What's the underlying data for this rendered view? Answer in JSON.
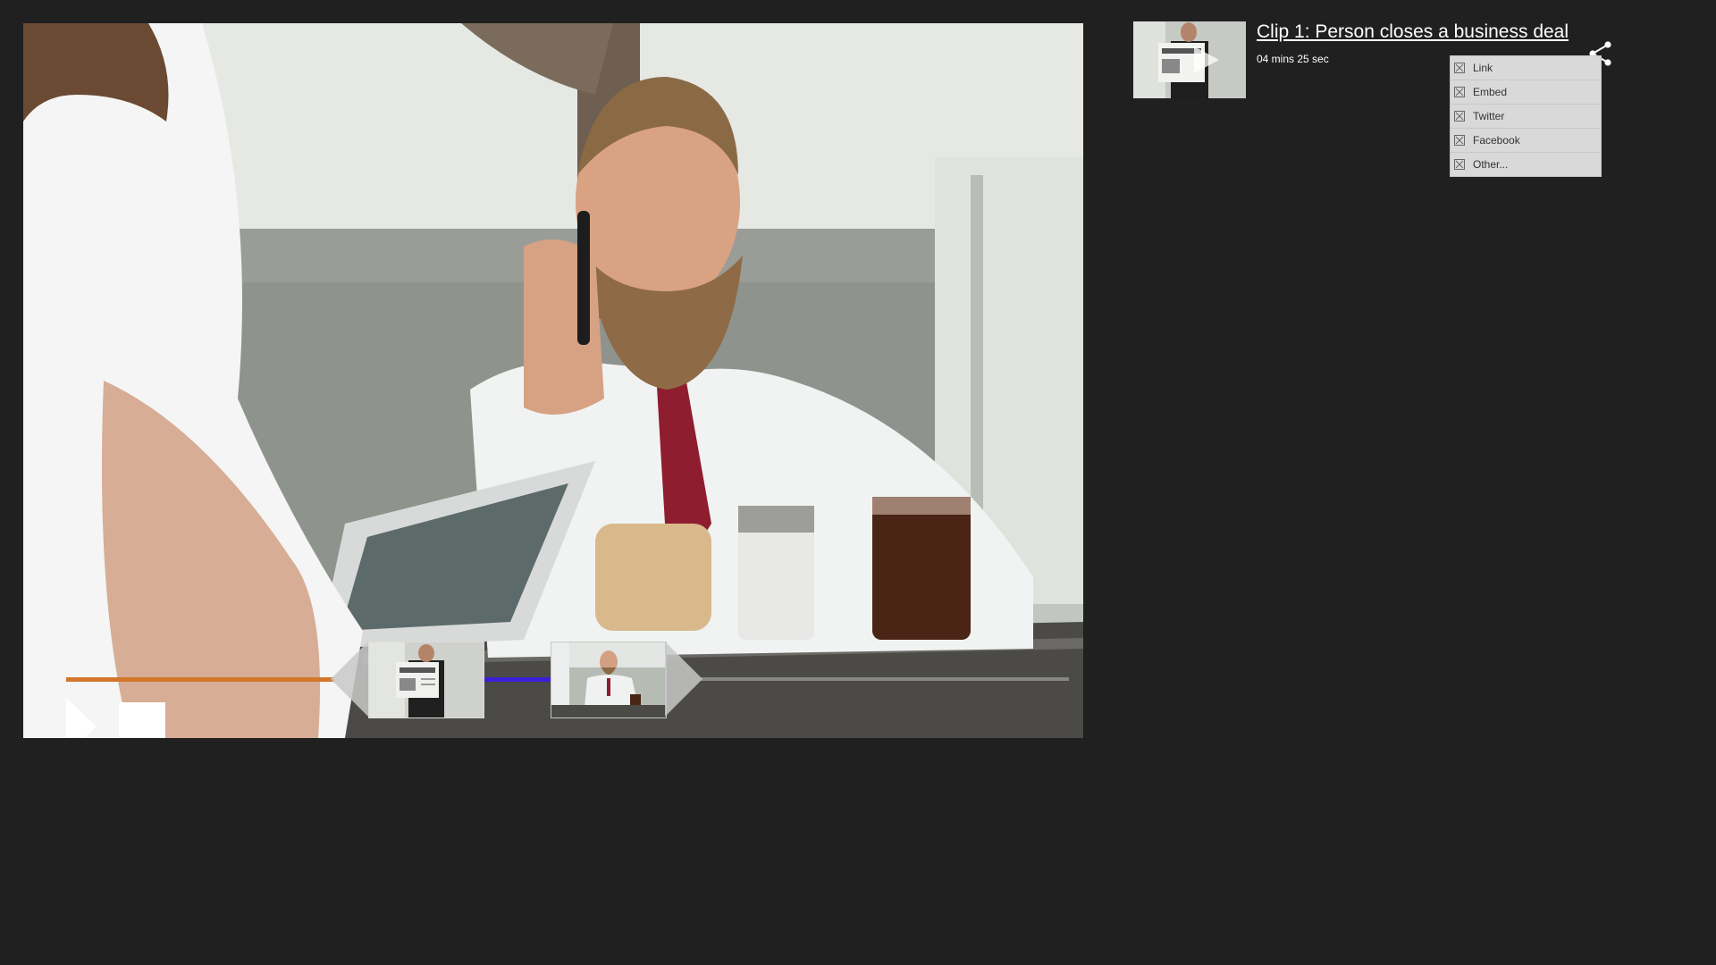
{
  "player": {
    "controls": {
      "play": "play-icon",
      "stop": "stop-icon",
      "previous": "chevron-left-icon",
      "next": "chevron-right-icon"
    },
    "progress": {
      "played_fraction": 0.28,
      "played_color": "#d4772a",
      "segment_color": "#3b1fd8"
    }
  },
  "clip": {
    "title": "Clip 1: Person closes a business deal ",
    "duration": "04 mins 25 sec"
  },
  "share_menu": {
    "icon": "share-icon",
    "items": [
      {
        "label": "Link",
        "icon": "broken-image-icon"
      },
      {
        "label": "Embed",
        "icon": "broken-image-icon"
      },
      {
        "label": "Twitter",
        "icon": "broken-image-icon"
      },
      {
        "label": "Facebook",
        "icon": "broken-image-icon"
      },
      {
        "label": "Other...",
        "icon": "broken-image-icon"
      }
    ]
  },
  "colors": {
    "background": "#202020",
    "menu_background": "#d9d9d9",
    "text_primary": "#ffffff"
  }
}
